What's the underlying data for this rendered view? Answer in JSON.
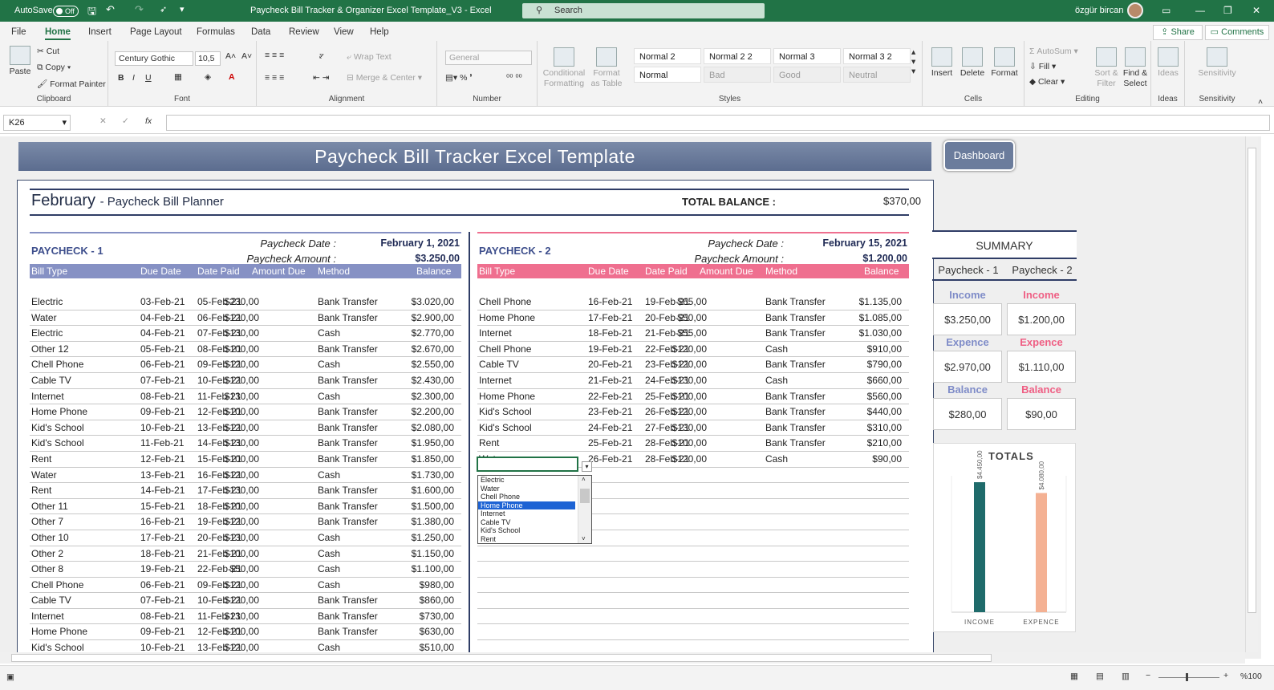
{
  "titlebar": {
    "autosave": "AutoSave",
    "autosave_state": "Off",
    "title": "Paycheck Bill Tracker & Organizer Excel Template_V3  -  Excel",
    "search": "Search",
    "user": "özgür bircan"
  },
  "menu": {
    "tabs": [
      "File",
      "Home",
      "Insert",
      "Page Layout",
      "Formulas",
      "Data",
      "Review",
      "View",
      "Help"
    ],
    "share": "Share",
    "comments": "Comments"
  },
  "ribbon": {
    "clipboard": {
      "label": "Clipboard",
      "paste": "Paste",
      "cut": "Cut",
      "copy": "Copy",
      "format_painter": "Format Painter"
    },
    "font": {
      "label": "Font",
      "name": "Century Gothic",
      "size": "10,5"
    },
    "alignment": {
      "label": "Alignment",
      "wrap": "Wrap Text",
      "merge": "Merge & Center"
    },
    "number": {
      "label": "Number",
      "format": "General"
    },
    "styles": {
      "label": "Styles",
      "conditional": "Conditional Formatting",
      "format_table": "Format as Table",
      "cells": [
        "Normal 2",
        "Normal 2 2",
        "Normal 3",
        "Normal 3 2",
        "Normal",
        "Bad",
        "Good",
        "Neutral"
      ]
    },
    "cells": {
      "label": "Cells",
      "insert": "Insert",
      "delete": "Delete",
      "format": "Format"
    },
    "editing": {
      "label": "Editing",
      "autosum": "AutoSum",
      "fill": "Fill",
      "clear": "Clear",
      "sort": "Sort & Filter",
      "find": "Find & Select"
    },
    "ideas": {
      "label": "Ideas",
      "btn": "Ideas"
    },
    "sensitivity": {
      "label": "Sensitivity",
      "btn": "Sensitivity"
    }
  },
  "formula_bar": {
    "name_box": "K26",
    "fx": "fx"
  },
  "sheet": {
    "banner": "Paycheck Bill Tracker Excel Template",
    "dashboard": "Dashboard",
    "month": "February",
    "month_sub": "- Paycheck Bill Planner",
    "total_label": "TOTAL BALANCE :",
    "total_value": "$370,00",
    "pc1": {
      "title": "PAYCHECK - 1",
      "date_label": "Paycheck Date :",
      "date": "February 1, 2021",
      "amount_label": "Paycheck Amount :",
      "amount": "$3.250,00"
    },
    "pc2": {
      "title": "PAYCHECK - 2",
      "date_label": "Paycheck Date :",
      "date": "February 15, 2021",
      "amount_label": "Paycheck Amount :",
      "amount": "$1.200,00"
    },
    "headers": [
      "Bill Type",
      "Due Date",
      "Date Paid",
      "Amount Due",
      "Method",
      "Balance"
    ],
    "pc1_rows": [
      [
        "Electric",
        "03-Feb-21",
        "05-Feb-21",
        "$230,00",
        "Bank Transfer",
        "$3.020,00"
      ],
      [
        "Water",
        "04-Feb-21",
        "06-Feb-21",
        "$120,00",
        "Bank Transfer",
        "$2.900,00"
      ],
      [
        "Electric",
        "04-Feb-21",
        "07-Feb-21",
        "$130,00",
        "Cash",
        "$2.770,00"
      ],
      [
        "Other 12",
        "05-Feb-21",
        "08-Feb-21",
        "$100,00",
        "Bank Transfer",
        "$2.670,00"
      ],
      [
        "Chell Phone",
        "06-Feb-21",
        "09-Feb-21",
        "$120,00",
        "Cash",
        "$2.550,00"
      ],
      [
        "Cable TV",
        "07-Feb-21",
        "10-Feb-21",
        "$120,00",
        "Bank Transfer",
        "$2.430,00"
      ],
      [
        "Internet",
        "08-Feb-21",
        "11-Feb-21",
        "$130,00",
        "Cash",
        "$2.300,00"
      ],
      [
        "Home Phone",
        "09-Feb-21",
        "12-Feb-21",
        "$100,00",
        "Bank Transfer",
        "$2.200,00"
      ],
      [
        "Kid's School",
        "10-Feb-21",
        "13-Feb-21",
        "$120,00",
        "Bank Transfer",
        "$2.080,00"
      ],
      [
        "Kid's School",
        "11-Feb-21",
        "14-Feb-21",
        "$130,00",
        "Bank Transfer",
        "$1.950,00"
      ],
      [
        "Rent",
        "12-Feb-21",
        "15-Feb-21",
        "$100,00",
        "Bank Transfer",
        "$1.850,00"
      ],
      [
        "Water",
        "13-Feb-21",
        "16-Feb-21",
        "$120,00",
        "Cash",
        "$1.730,00"
      ],
      [
        "Rent",
        "14-Feb-21",
        "17-Feb-21",
        "$130,00",
        "Bank Transfer",
        "$1.600,00"
      ],
      [
        "Other 11",
        "15-Feb-21",
        "18-Feb-21",
        "$100,00",
        "Bank Transfer",
        "$1.500,00"
      ],
      [
        "Other 7",
        "16-Feb-21",
        "19-Feb-21",
        "$120,00",
        "Bank Transfer",
        "$1.380,00"
      ],
      [
        "Other 10",
        "17-Feb-21",
        "20-Feb-21",
        "$130,00",
        "Cash",
        "$1.250,00"
      ],
      [
        "Other 2",
        "18-Feb-21",
        "21-Feb-21",
        "$100,00",
        "Cash",
        "$1.150,00"
      ],
      [
        "Other 8",
        "19-Feb-21",
        "22-Feb-21",
        "$50,00",
        "Cash",
        "$1.100,00"
      ],
      [
        "Chell Phone",
        "06-Feb-21",
        "09-Feb-21",
        "$120,00",
        "Cash",
        "$980,00"
      ],
      [
        "Cable TV",
        "07-Feb-21",
        "10-Feb-21",
        "$120,00",
        "Bank Transfer",
        "$860,00"
      ],
      [
        "Internet",
        "08-Feb-21",
        "11-Feb-21",
        "$130,00",
        "Bank Transfer",
        "$730,00"
      ],
      [
        "Home Phone",
        "09-Feb-21",
        "12-Feb-21",
        "$100,00",
        "Bank Transfer",
        "$630,00"
      ],
      [
        "Kid's School",
        "10-Feb-21",
        "13-Feb-21",
        "$120,00",
        "Cash",
        "$510,00"
      ]
    ],
    "pc2_rows": [
      [
        "Chell Phone",
        "16-Feb-21",
        "19-Feb-21",
        "$65,00",
        "Bank Transfer",
        "$1.135,00"
      ],
      [
        "Home Phone",
        "17-Feb-21",
        "20-Feb-21",
        "$50,00",
        "Bank Transfer",
        "$1.085,00"
      ],
      [
        "Internet",
        "18-Feb-21",
        "21-Feb-21",
        "$55,00",
        "Bank Transfer",
        "$1.030,00"
      ],
      [
        "Chell Phone",
        "19-Feb-21",
        "22-Feb-21",
        "$120,00",
        "Cash",
        "$910,00"
      ],
      [
        "Cable TV",
        "20-Feb-21",
        "23-Feb-21",
        "$120,00",
        "Bank Transfer",
        "$790,00"
      ],
      [
        "Internet",
        "21-Feb-21",
        "24-Feb-21",
        "$130,00",
        "Cash",
        "$660,00"
      ],
      [
        "Home Phone",
        "22-Feb-21",
        "25-Feb-21",
        "$100,00",
        "Bank Transfer",
        "$560,00"
      ],
      [
        "Kid's School",
        "23-Feb-21",
        "26-Feb-21",
        "$120,00",
        "Bank Transfer",
        "$440,00"
      ],
      [
        "Kid's School",
        "24-Feb-21",
        "27-Feb-21",
        "$130,00",
        "Bank Transfer",
        "$310,00"
      ],
      [
        "Rent",
        "25-Feb-21",
        "28-Feb-21",
        "$100,00",
        "Bank Transfer",
        "$210,00"
      ],
      [
        "Water",
        "26-Feb-21",
        "28-Feb-21",
        "$120,00",
        "Cash",
        "$90,00"
      ]
    ],
    "dropdown": {
      "items": [
        "Electric",
        "Water",
        "Chell Phone",
        "Home Phone",
        "Internet",
        "Cable TV",
        "Kid's School",
        "Rent"
      ],
      "selected": "Home Phone"
    },
    "summary": {
      "title": "SUMMARY",
      "col1": "Paycheck - 1",
      "col2": "Paycheck - 2",
      "income_label": "Income",
      "expence_label": "Expence",
      "balance_label": "Balance",
      "pc1": {
        "income": "$3.250,00",
        "expence": "$2.970,00",
        "balance": "$280,00"
      },
      "pc2": {
        "income": "$1.200,00",
        "expence": "$1.110,00",
        "balance": "$90,00"
      }
    }
  },
  "chart_data": {
    "type": "bar",
    "title": "TOTALS",
    "categories": [
      "INCOME",
      "EXPENCE"
    ],
    "values": [
      4450,
      4080
    ],
    "labels": [
      "$4.450,00",
      "$4.080,00"
    ],
    "colors": [
      "#1f6b6b",
      "#f4b193"
    ],
    "ylim": [
      0,
      4450
    ]
  },
  "colors": {
    "excel_green": "#217346",
    "pc1_accent": "#8691c4",
    "pc2_accent": "#ef6f8f",
    "pc1_label": "#7f8cc8",
    "pc2_label": "#ef5f84"
  },
  "status": {
    "zoom": "%100"
  }
}
